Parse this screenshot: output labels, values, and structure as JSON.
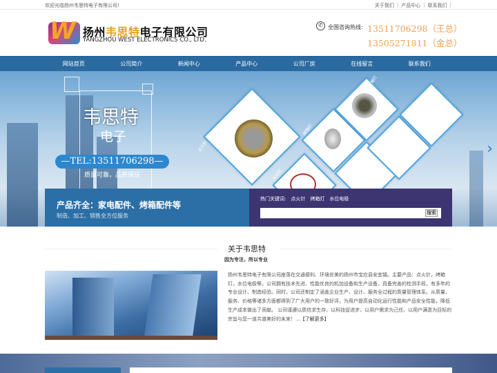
{
  "topbar": {
    "welcome": "欢迎光临扬州韦思特电子有限公司!",
    "links": [
      "关于我们",
      "产品中心",
      "联系我们"
    ]
  },
  "header": {
    "company_prefix": "扬州",
    "company_highlight": "韦思特",
    "company_suffix": "电子有限公司",
    "company_en": "YANGZHOU WEST ELECTRONICS CO., LTD.",
    "hotline_label": "全国咨询热线:",
    "phones": [
      "13511706298（王总）",
      "13505271811（金总）"
    ],
    "logo_letter": "W"
  },
  "nav": [
    "网站首页",
    "公司简介",
    "新闻中心",
    "产品中心",
    "公司厂房",
    "在线留言",
    "联系我们"
  ],
  "banner": {
    "title": "韦思特",
    "subtitle": "电子",
    "tel": "—TEL:13511706298—",
    "slogan": "质量可靠，品质保证",
    "product_labels": [
      "点火针",
      "烤箱灯",
      "烤箱灯",
      "水位电极",
      "点火针",
      "水位电极"
    ]
  },
  "infobar": {
    "title": "产品齐全：家电配件、烤箱配件等",
    "subtitle": "制造、加工、销售全方位服务",
    "hot_label": "热门关键词:",
    "hot_keywords": [
      "点火针",
      "烤箱灯",
      "水位电极"
    ],
    "search_value": "",
    "search_button": "搜索"
  },
  "about": {
    "title": "关于韦思特",
    "subtitle": "因为专注，所以专业",
    "text": "扬州韦思特电子有限公司座落在交通便利、环境优美的扬州市宝应县安宜镇。主要产品：点火针，烤箱灯，水位电极等。公司拥有技术先进、性能优良的机加设备和生产设备，具备完善的检测手段，有多年的专业设计、制造经验。同时，公司还制定了涵盖企业生产、设计、服务全过程的质量管理体系。从质量、服务、价格等诸多方面都得到了广大用户的一致好评，为用户提高自动化运行性能和产品安全性能，降低生产成本做出了贡献。 公司谨遵以质信求生存、以科技促进步、以用户需求为己任、以用户满意为目标的宗旨与您一道共谱美好的未来！...",
    "more": "【了解更多】"
  },
  "colors": {
    "nav": "#2a6aa0",
    "accent": "#e8a21c",
    "phone": "#f0a055",
    "infobar_left": "#2b6fa6",
    "infobar_right": "#3c3572"
  }
}
